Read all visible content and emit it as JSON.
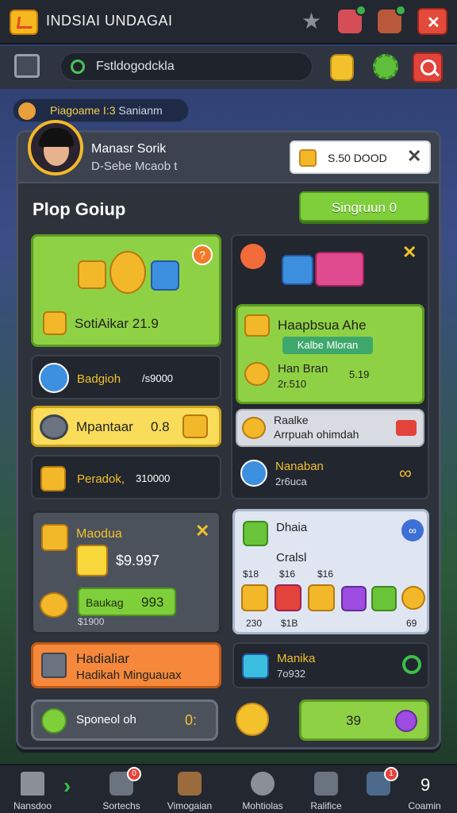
{
  "app": {
    "title": "INDSIAI UNDAGAI"
  },
  "search": {
    "placeholder": "Fstldogodckla"
  },
  "player_pill": {
    "name": "Piagoame I:3",
    "tag": "Sanianm"
  },
  "profile": {
    "name": "Manasr Sorik",
    "subtitle": "D-Sebe Mcaob t",
    "balance": "S.50 DOOD"
  },
  "section": {
    "title": "Plop Goiup",
    "signup_label": "Singruun 0"
  },
  "cards": {
    "green_card": {
      "label": "SotiAikar 21.9"
    },
    "gift_card": {
      "title": "Haapbsua Ahe",
      "badge": "Kalbe Mloran",
      "line1": "Han Bran",
      "line2": "2r.510",
      "line2_right": "5.19"
    },
    "row1": {
      "label": "Badgioh",
      "value": "/s9000"
    },
    "row2": {
      "label": "Mpantaar",
      "value": "0.8"
    },
    "row3": {
      "label": "Peradok,",
      "value": "310000"
    },
    "right_row1": {
      "title": "Raalke",
      "subtitle": "Arrpuah ohimdah"
    },
    "right_row2": {
      "title": "Nanaban",
      "subtitle": "2r6uca"
    },
    "mango_card": {
      "title": "Maodua",
      "price": "$9.997",
      "btn_label": "Baukag",
      "btn_value": "993",
      "foot": "$1900"
    },
    "shop_card": {
      "title": "Dhaia",
      "subtitle": "Cralsl",
      "prices": [
        "$18",
        "$16",
        "$16"
      ],
      "foot_left": "230",
      "foot_mid": "$1B",
      "foot_right": "69"
    },
    "orange_card": {
      "title": "Hadialiar",
      "subtitle": "Hadikah Minguauax"
    },
    "manika_card": {
      "title": "Manika",
      "value": "7o932"
    },
    "bottom_left": {
      "label": "Sponeol oh"
    },
    "bottom_mid": {
      "label": "0:"
    },
    "bottom_right": {
      "label": "39"
    }
  },
  "nav": [
    {
      "label": "Nansdoo"
    },
    {
      "label": "Sortechs",
      "badge": "0"
    },
    {
      "label": "Vimogaian"
    },
    {
      "label": "Mohtiolas"
    },
    {
      "label": "Ralifice"
    },
    {
      "label": "Coamin",
      "badge": "1"
    },
    {
      "label": "9"
    }
  ],
  "colors": {
    "accent_green": "#8fd144",
    "accent_red": "#e2433a",
    "gold": "#f2b82a",
    "panel": "#2d323b"
  }
}
